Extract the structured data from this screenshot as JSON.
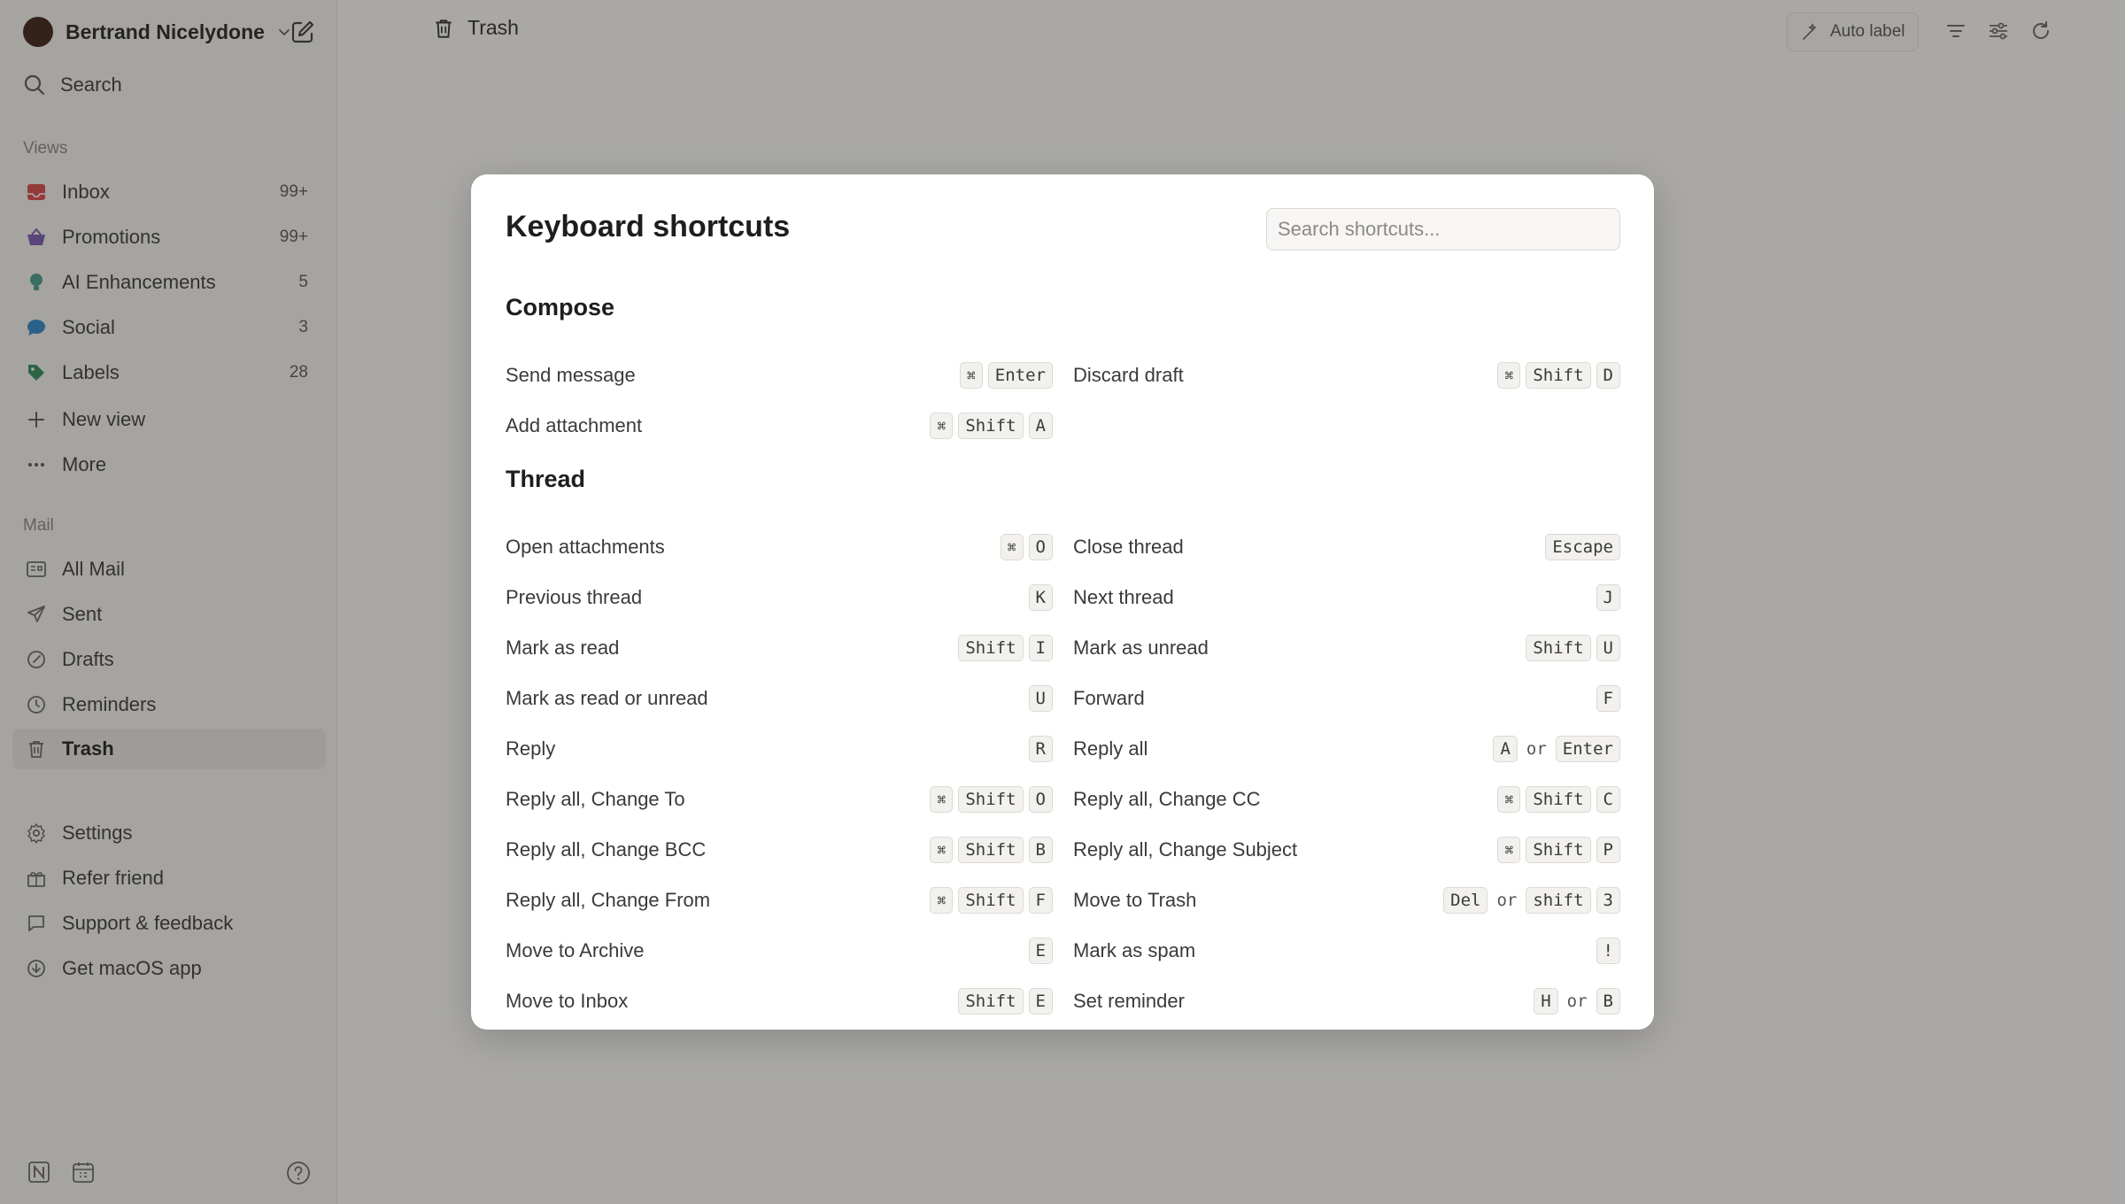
{
  "account": {
    "name": "Bertrand Nicelydone"
  },
  "search_label": "Search",
  "views": {
    "heading": "Views",
    "items": [
      {
        "label": "Inbox",
        "count": "99+",
        "icon": "inbox-icon",
        "color": "#d9484a"
      },
      {
        "label": "Promotions",
        "count": "99+",
        "icon": "basket-icon",
        "color": "#7a5ab0"
      },
      {
        "label": "AI Enhancements",
        "count": "5",
        "icon": "bulb-icon",
        "color": "#4a9a8a"
      },
      {
        "label": "Social",
        "count": "3",
        "icon": "chat-bubble-icon",
        "color": "#2f86c9"
      },
      {
        "label": "Labels",
        "count": "28",
        "icon": "tag-icon",
        "color": "#2f8c5a"
      }
    ],
    "new_view": "New view",
    "more": "More"
  },
  "mail": {
    "heading": "Mail",
    "items": [
      {
        "label": "All Mail",
        "icon": "all-mail-icon"
      },
      {
        "label": "Sent",
        "icon": "send-icon"
      },
      {
        "label": "Drafts",
        "icon": "drafts-icon"
      },
      {
        "label": "Reminders",
        "icon": "clock-icon"
      },
      {
        "label": "Trash",
        "icon": "trash-icon",
        "active": true
      }
    ]
  },
  "footer_links": [
    {
      "label": "Settings",
      "icon": "gear-icon"
    },
    {
      "label": "Refer friend",
      "icon": "gift-icon"
    },
    {
      "label": "Support & feedback",
      "icon": "feedback-icon"
    },
    {
      "label": "Get macOS app",
      "icon": "download-icon"
    }
  ],
  "header": {
    "title": "Trash",
    "auto_label": "Auto label"
  },
  "modal": {
    "title": "Keyboard shortcuts",
    "search_placeholder": "Search shortcuts...",
    "compose": {
      "heading": "Compose",
      "rows": [
        {
          "left": {
            "label": "Send message",
            "keys": [
              "⌘",
              "Enter"
            ]
          },
          "right": {
            "label": "Discard draft",
            "keys": [
              "⌘",
              "Shift",
              "D"
            ]
          }
        },
        {
          "left": {
            "label": "Add attachment",
            "keys": [
              "⌘",
              "Shift",
              "A"
            ]
          }
        }
      ]
    },
    "thread": {
      "heading": "Thread",
      "rows": [
        {
          "left": {
            "label": "Open attachments",
            "keys": [
              "⌘",
              "O"
            ]
          },
          "right": {
            "label": "Close thread",
            "keys": [
              "Escape"
            ]
          }
        },
        {
          "left": {
            "label": "Previous thread",
            "keys": [
              "K"
            ]
          },
          "right": {
            "label": "Next thread",
            "keys": [
              "J"
            ]
          }
        },
        {
          "left": {
            "label": "Mark as read",
            "keys": [
              "Shift",
              "I"
            ]
          },
          "right": {
            "label": "Mark as unread",
            "keys": [
              "Shift",
              "U"
            ]
          }
        },
        {
          "left": {
            "label": "Mark as read or unread",
            "keys": [
              "U"
            ]
          },
          "right": {
            "label": "Forward",
            "keys": [
              "F"
            ]
          }
        },
        {
          "left": {
            "label": "Reply",
            "keys": [
              "R"
            ]
          },
          "right": {
            "label": "Reply all",
            "keys": [
              "A",
              "or",
              "Enter"
            ]
          }
        },
        {
          "left": {
            "label": "Reply all, Change To",
            "keys": [
              "⌘",
              "Shift",
              "O"
            ]
          },
          "right": {
            "label": "Reply all, Change CC",
            "keys": [
              "⌘",
              "Shift",
              "C"
            ]
          }
        },
        {
          "left": {
            "label": "Reply all, Change BCC",
            "keys": [
              "⌘",
              "Shift",
              "B"
            ]
          },
          "right": {
            "label": "Reply all, Change Subject",
            "keys": [
              "⌘",
              "Shift",
              "P"
            ]
          }
        },
        {
          "left": {
            "label": "Reply all, Change From",
            "keys": [
              "⌘",
              "Shift",
              "F"
            ]
          },
          "right": {
            "label": "Move to Trash",
            "keys": [
              "Del",
              "or",
              "shift",
              "3"
            ]
          }
        },
        {
          "left": {
            "label": "Move to Archive",
            "keys": [
              "E"
            ]
          },
          "right": {
            "label": "Mark as spam",
            "keys": [
              "!"
            ]
          }
        },
        {
          "left": {
            "label": "Move to Inbox",
            "keys": [
              "Shift",
              "E"
            ]
          },
          "right": {
            "label": "Set reminder",
            "keys": [
              "H",
              "or",
              "B"
            ]
          }
        }
      ]
    }
  }
}
